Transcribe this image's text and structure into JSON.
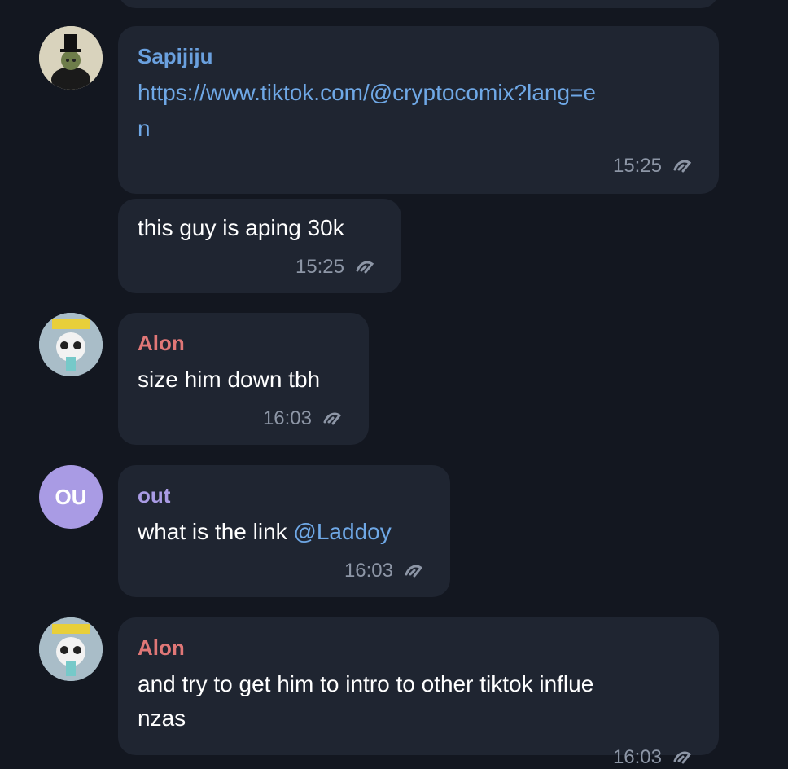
{
  "colors": {
    "background": "#131720",
    "bubble": "#1f2531",
    "link": "#6fa8e6",
    "meta": "#8d96a6",
    "sapijiju_name": "#6aa0de",
    "alon_name": "#e07777",
    "out_name": "#a99be4",
    "out_avatar": "#a99be4"
  },
  "messages": [
    {
      "sender": "Sapijiju",
      "avatar_icon": "top-hat-character-avatar",
      "link_line1": "https://www.tiktok.com/@cryptocomix?lang=e",
      "link_line2": "n",
      "time": "15:25",
      "status_icon": "sent-check-icon"
    },
    {
      "text": "this guy is aping 30k",
      "time": "15:25",
      "status_icon": "sent-check-icon"
    },
    {
      "sender": "Alon",
      "avatar_icon": "cartoon-cat-avatar",
      "text": "size him down tbh",
      "time": "16:03",
      "status_icon": "sent-check-icon"
    },
    {
      "sender": "out",
      "avatar_initials": "OU",
      "text_prefix": "what is the link ",
      "mention": "@Laddoy",
      "time": "16:03",
      "status_icon": "sent-check-icon"
    },
    {
      "sender": "Alon",
      "avatar_icon": "cartoon-cat-avatar",
      "text_line1": "and try to get him to intro to other tiktok influe",
      "text_line2": "nzas",
      "time": "16:03",
      "status_icon": "sent-check-icon"
    }
  ]
}
